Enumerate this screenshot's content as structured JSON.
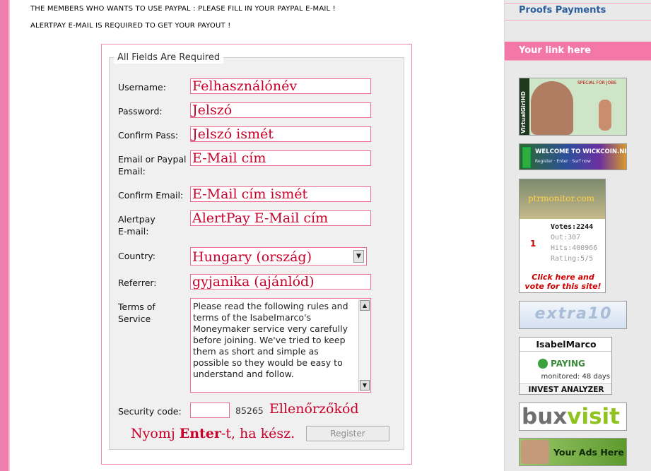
{
  "notices": {
    "paypal": "THE MEMBERS WHO WANTS TO USE PAYPAL : PLEASE FILL IN YOUR PAYPAL E-MAIL !",
    "alertpay": "ALERTPAY E-MAIL IS REQUIRED TO GET YOUR PAYOUT !"
  },
  "form": {
    "legend": "All Fields Are Required",
    "username_label": "Username:",
    "username_value": "Felhasználónév",
    "password_label": "Password:",
    "password_value": "Jelszó",
    "confirm_pass_label": "Confirm Pass:",
    "confirm_pass_value": "Jelszó ismét",
    "email_label_line1": "Email or Paypal",
    "email_label_line2": "Email:",
    "email_value": "E-Mail cím",
    "confirm_email_label": "Confirm Email:",
    "confirm_email_value": "E-Mail cím ismét",
    "alertpay_label_line1": "Alertpay",
    "alertpay_label_line2": "E-mail:",
    "alertpay_value": "AlertPay E-Mail cím",
    "country_label": "Country:",
    "country_value": "Hungary (ország)",
    "referrer_label": "Referrer:",
    "referrer_value": "gyjanika (ajánlód)",
    "terms_label_line1": "Terms of",
    "terms_label_line2": "Service",
    "terms_text": "Please read the following rules and terms of the IsabeImarco's Moneymaker service very carefully before joining. We've tried to keep them as short and simple as possible so they would be easy to understand and follow.",
    "security_label": "Security code:",
    "security_code": "85265",
    "security_hint": "Ellenőrzőkód",
    "enter_hint_pre": "Nyomj ",
    "enter_hint_bold": "Enter",
    "enter_hint_post": "-t, ha kész.",
    "register_label": "Register"
  },
  "sidebar": {
    "proofs_payments": "Proofs Payments",
    "your_link_here": "Your link here",
    "link_color": "#2b5f9e",
    "pink_bar_color": "#f378a8"
  },
  "banners": {
    "virtualgirl": {
      "side_text": "VirtualGirlHD",
      "top_text": "SPECIAL FOR JOBS"
    },
    "welcome": {
      "text": "WELCOME TO WICKCOIN.NET",
      "sub": "Register · Enter · Surf now"
    },
    "monitor": {
      "site": "ptrmonitor.com",
      "rank": "1",
      "votes": "Votes:2244",
      "out": "Out:307",
      "hits": "Hits:400966",
      "rating": "Rating:5/5",
      "cta_line1": "Click here and",
      "cta_line2": "vote for this site!"
    },
    "extra10": {
      "text": "extra10"
    },
    "analyzer": {
      "name": "IsabelMarco",
      "status": "PAYING",
      "monitored": "monitored: 48 days",
      "footer": "INVEST ANALYZER"
    },
    "buxvisit": {
      "part1": "bux",
      "part2": "visit"
    },
    "your_ads": {
      "text": "Your Ads Here"
    }
  }
}
